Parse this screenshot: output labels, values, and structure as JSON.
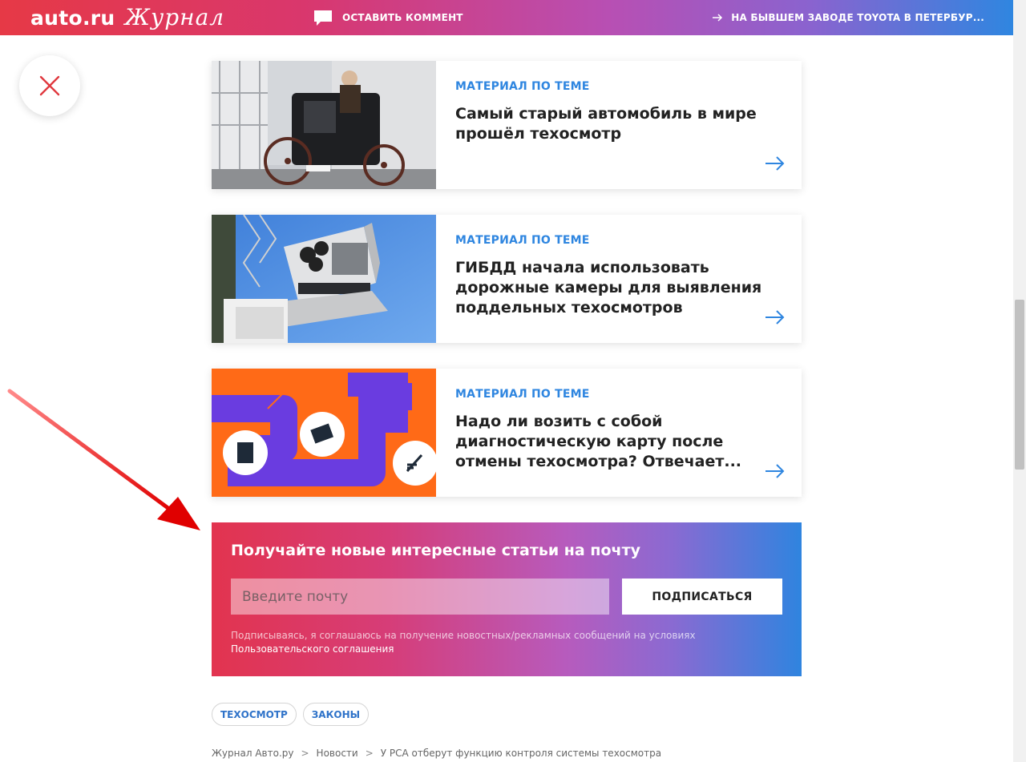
{
  "header": {
    "logo_auto": "auto.ru",
    "logo_journal": "Журнал",
    "comment_label": "ОСТАВИТЬ КОММЕНТ",
    "next_article_label": "НА БЫВШЕМ ЗАВОДЕ TOYOTA В ПЕТЕРБУР..."
  },
  "colors": {
    "accent_blue": "#2f86e0",
    "accent_red": "#e63946",
    "close_x": "#e0393f"
  },
  "related": [
    {
      "kicker": "МАТЕРИАЛ ПО ТЕМЕ",
      "title": "Самый старый автомобиль в мире прошёл техосмотр",
      "image": "old-car-photo"
    },
    {
      "kicker": "МАТЕРИАЛ ПО ТЕМЕ",
      "title": "ГИБДД начала использовать дорожные камеры для выявления поддельных техосмотров",
      "image": "traffic-camera-photo"
    },
    {
      "kicker": "МАТЕРИАЛ ПО ТЕМЕ",
      "title": "Надо ли возить с собой диагностическую карту после отмены техосмотра? Отвечает...",
      "image": "illustration-documents"
    }
  ],
  "subscribe": {
    "title": "Получайте новые интересные статьи на почту",
    "placeholder": "Введите почту",
    "button": "ПОДПИСАТЬСЯ",
    "note": "Подписываясь, я соглашаюсь на получение новостных/рекламных сообщений на условиях",
    "link": "Пользовательского соглашения"
  },
  "tags": [
    "ТЕХОСМОТР",
    "ЗАКОНЫ"
  ],
  "breadcrumb": {
    "items": [
      "Журнал Авто.ру",
      "Новости",
      "У РСА отберут функцию контроля системы техосмотра"
    ],
    "separator": ">"
  }
}
